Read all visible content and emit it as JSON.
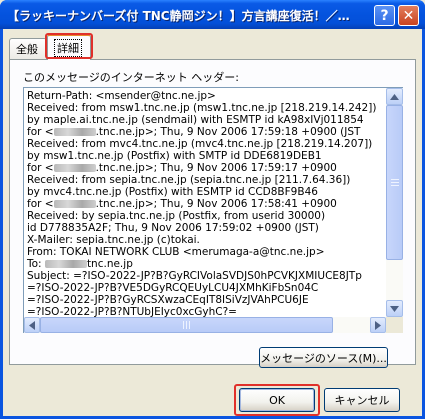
{
  "window": {
    "title": "【ラッキーナンバーズ付 TNC静岡ジン！】方言講座復活！／…",
    "help_label": "?",
    "close_label": "✕"
  },
  "tabs": [
    {
      "label": "全般",
      "active": false
    },
    {
      "label": "詳細",
      "active": true
    }
  ],
  "panel": {
    "header_label": "このメッセージのインターネット ヘッダー:",
    "header_lines": [
      {
        "text": "Return-Path: <msender@tnc.ne.jp>"
      },
      {
        "text": "Received: from msw1.tnc.ne.jp (msw1.tnc.ne.jp [218.219.14.242])"
      },
      {
        "text": "      by maple.ai.tnc.ne.jp (sendmail) with ESMTP id kA98xIVj011854"
      },
      {
        "text": "      for <",
        "redacted": true,
        "after": ".tnc.ne.jp>; Thu, 9 Nov 2006 17:59:18 +0900 (JST"
      },
      {
        "text": "Received: from mvc4.tnc.ne.jp (mvc4.tnc.ne.jp [218.219.14.207])"
      },
      {
        "text": "           by msw1.tnc.ne.jp (Postfix) with SMTP id DDE6819DEB1"
      },
      {
        "text": "           for <",
        "redacted": true,
        "after": ".tnc.ne.jp>; Thu, 9 Nov 2006 17:59:17 +0900"
      },
      {
        "text": "Received: from sepia.tnc.ne.jp (sepia.tnc.ne.jp [211.7.64.36])"
      },
      {
        "text": "           by mvc4.tnc.ne.jp (Postfix) with ESMTP id CCD8BF9B46"
      },
      {
        "text": "           for <",
        "redacted": true,
        "after": ".tnc.ne.jp>; Thu, 9 Nov 2006 17:58:41 +0900"
      },
      {
        "text": "Received: by sepia.tnc.ne.jp (Postfix, from userid 30000)"
      },
      {
        "text": "      id D778835A2F; Thu, 9 Nov 2006 17:59:02 +0900 (JST)"
      },
      {
        "text": "X-Mailer: sepia.tnc.ne.jp (c)tokai."
      },
      {
        "text": "From: TOKAI NETWORK CLUB <merumaga-a@tnc.ne.jp>"
      },
      {
        "text": "To: ",
        "redacted": true,
        "after": "tnc.ne.jp"
      },
      {
        "text": "Subject: =?ISO-2022-JP?B?GyRCIVolaSVDJS0hPCVKJXMIUCE8JTp"
      },
      {
        "text": "       =?ISO-2022-JP?B?VE5DGyRCQEUyLCU4JXMhKiFbSn04C"
      },
      {
        "text": "       =?ISO-2022-JP?B?GyRCSXwzaCEqIT8ISiVzJVAhPCU6JE"
      },
      {
        "text": "       =?ISO-2022-JP?B?NTUbJEIyc0xcGyhC?="
      }
    ],
    "source_button_label": "メッセージのソース(M)..."
  },
  "buttons": {
    "ok_label": "OK",
    "cancel_label": "キャンセル"
  }
}
